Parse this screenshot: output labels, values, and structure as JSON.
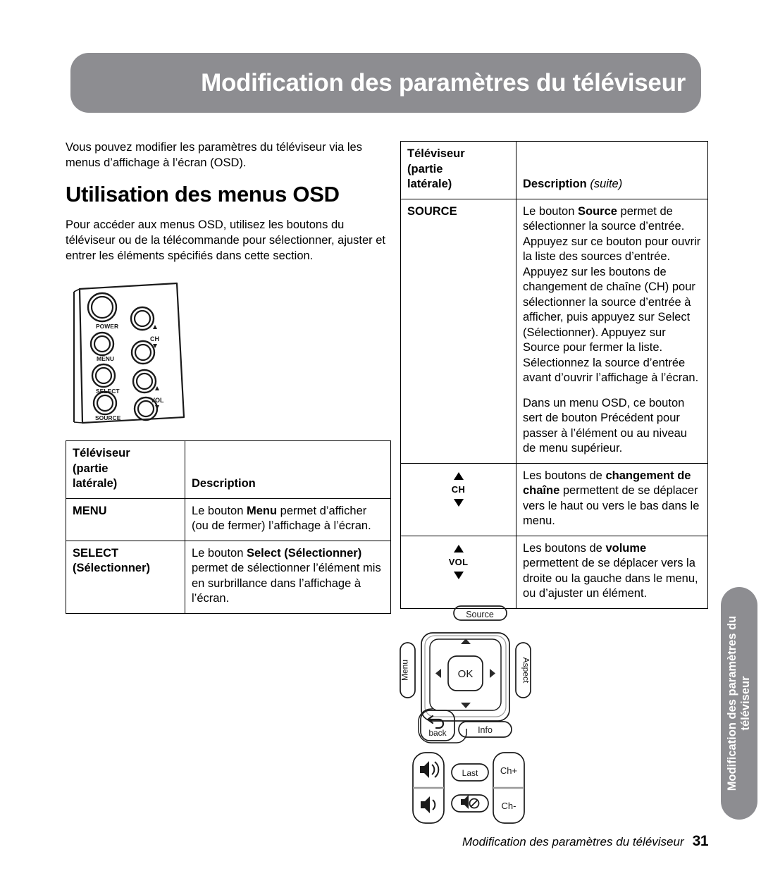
{
  "page": {
    "banner_title": "Modification des paramètres du téléviseur",
    "side_tab_text": "Modification des paramètres du\ntéléviseur",
    "footer_text": "Modification des paramètres du téléviseur",
    "page_number": "31",
    "banner_color": "#8d8d91"
  },
  "left_column": {
    "intro": "Vous pouvez modifier les paramètres du téléviseur via les menus d’affichage à l’écran (OSD).",
    "heading": "Utilisation des menus OSD",
    "paragraph": "Pour accéder aux menus OSD, utilisez les boutons du téléviseur ou de la télécommande pour sélectionner, ajuster et entrer les éléments spécifiés dans cette section.",
    "tv_panel": {
      "caption_power": "POWER",
      "caption_menu": "MENU",
      "caption_select": "SELECT",
      "caption_source": "SOURCE",
      "caption_ch": "CH",
      "caption_vol": "VOL"
    },
    "table": {
      "header_key": "Téléviseur (partie latérale)",
      "header_key_lines": [
        "Téléviseur",
        "(partie",
        "latérale)"
      ],
      "header_desc": "Description",
      "rows": [
        {
          "key": "MENU",
          "key_lines": [
            "MENU"
          ],
          "desc_pre": "Le bouton ",
          "desc_bold": "Menu",
          "desc_post": " permet d’afficher (ou de fermer) l’affichage à l’écran."
        },
        {
          "key": "SELECT (Sélectionner)",
          "key_lines": [
            "SELECT",
            "(Sélectionner)"
          ],
          "desc_pre": "Le bouton ",
          "desc_bold": "Select (Sélectionner)",
          "desc_post": " permet de sélectionner l’élément mis en surbrillance dans l’affichage à l’écran."
        }
      ]
    }
  },
  "right_column": {
    "table": {
      "header_key_lines": [
        "Téléviseur",
        "(partie",
        "latérale)"
      ],
      "header_desc": "Description",
      "header_desc_suite": "(suite)",
      "source_row": {
        "key": "SOURCE",
        "para1_pre": "Le bouton ",
        "para1_bold": "Source",
        "para1_post": " permet de sélectionner la source d’entrée. Appuyez sur ce bouton pour ouvrir la liste des sources d’entrée. Appuyez sur les boutons de changement de chaîne (CH) pour sélectionner la source d’entrée à afficher, puis appuyez sur Select (Sélectionner). Appuyez sur Source pour fermer la liste. Sélectionnez la source d’entrée avant d’ouvrir l’affichage à l’écran.",
        "para2": "Dans un menu OSD, ce bouton sert de bouton Précédent pour passer à l’élément ou au niveau de menu supérieur."
      },
      "ch_row": {
        "key_label": "CH",
        "desc_pre": "Les boutons de ",
        "desc_bold": "changement de chaîne",
        "desc_post": " permettent de se déplacer vers le haut ou vers le bas dans le menu."
      },
      "vol_row": {
        "key_label": "VOL",
        "desc_pre": "Les boutons de ",
        "desc_bold": "volume",
        "desc_post": " permettent de se déplacer vers la droite ou la gauche dans le menu, ou d’ajuster un élément."
      }
    },
    "remote": {
      "source": "Source",
      "menu": "Menu",
      "aspect": "Aspect",
      "ok": "OK",
      "back": "back",
      "info": "Info",
      "last": "Last",
      "ch_plus": "Ch+",
      "ch_minus": "Ch-"
    }
  }
}
